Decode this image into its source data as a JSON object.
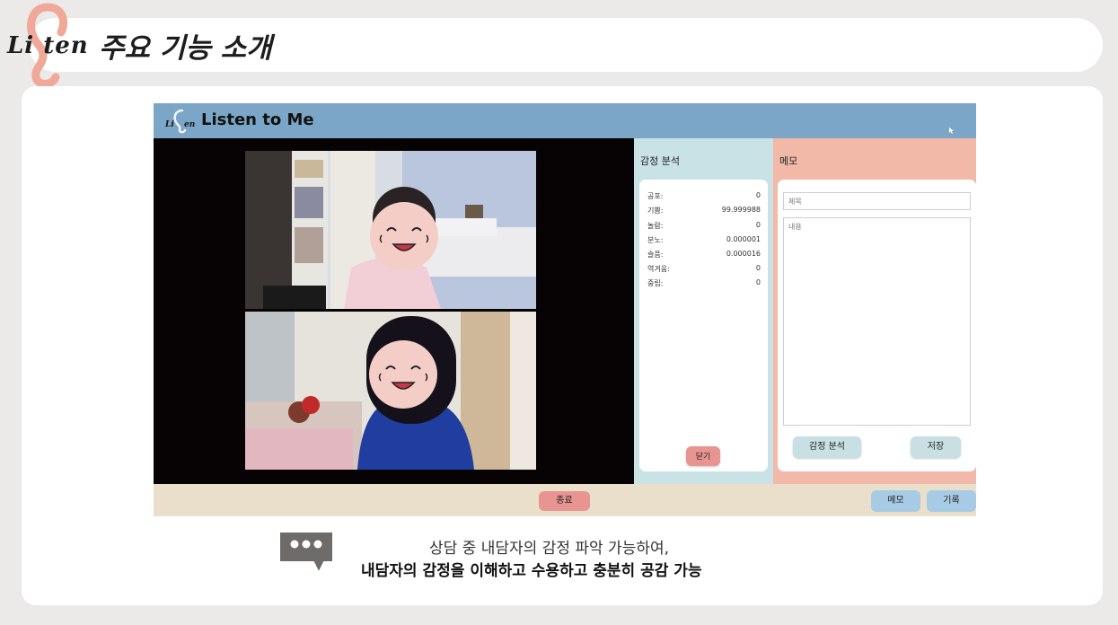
{
  "slide": {
    "logo_text": "Li  t",
    "logo_text2": "en",
    "title": "주요 기능 소개"
  },
  "app": {
    "title": "Listen to Me",
    "emotion_panel": {
      "title": "감정 분석",
      "rows": [
        {
          "label": "공포:",
          "value": "0"
        },
        {
          "label": "기쁨:",
          "value": "99.999988"
        },
        {
          "label": "놀람:",
          "value": "0"
        },
        {
          "label": "분노:",
          "value": "0.000001"
        },
        {
          "label": "슬픔:",
          "value": "0.000016"
        },
        {
          "label": "역겨움:",
          "value": "0"
        },
        {
          "label": "중립:",
          "value": "0"
        }
      ],
      "close_label": "닫기"
    },
    "memo_panel": {
      "title": "메모",
      "title_placeholder": "제목",
      "content_placeholder": "내용",
      "analyze_label": "감정 분석",
      "save_label": "저장"
    },
    "bottom": {
      "end_label": "종료",
      "memo_label": "메모",
      "record_label": "기록"
    }
  },
  "caption": {
    "line1": "상담 중 내담자의 감정 파악 가능하여,",
    "line2": "내담자의 감정을 이해하고 수용하고 충분히 공감 가능"
  },
  "colors": {
    "titlebar": "#7ba6c8",
    "emotion_panel": "#c8e2e6",
    "memo_panel": "#f3b9a8",
    "end_button": "#e89591",
    "nav_button": "#a7cbe5"
  }
}
